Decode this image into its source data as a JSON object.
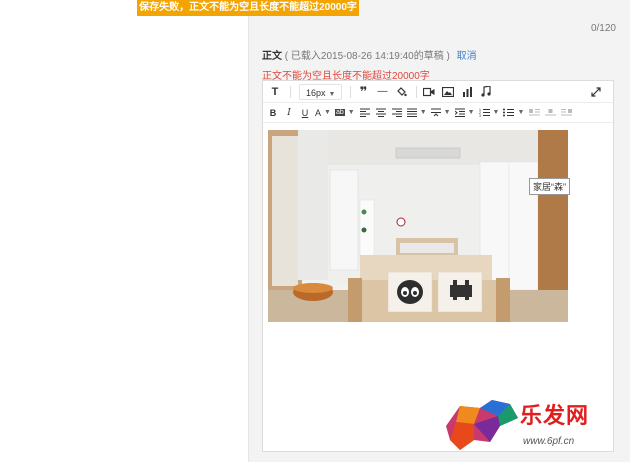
{
  "banner": {
    "error_message": "保存失败，正文不能为空且长度不能超过20000字"
  },
  "title_field": {
    "char_count": "0/120"
  },
  "body_field": {
    "label": "正文",
    "draft_note": "( 已载入2015-08-26 14:19:40的草稿 )",
    "cancel_label": "取消",
    "error_text": "正文不能为空且长度不能超过20000字"
  },
  "toolbar_main": {
    "text_icon": "T",
    "font_size": "16px",
    "quote_icon": "❞",
    "hr_icon": "—"
  },
  "toolbar_format": {
    "bold": "B",
    "italic": "I",
    "underline": "U",
    "font_color": "A",
    "bg_color": "ab"
  },
  "image": {
    "tooltip": "家居“森”"
  },
  "watermark": {
    "brand": "乐发网",
    "url": "www.6pf.cn"
  },
  "colors": {
    "banner_bg": "#f3a400",
    "error_red": "#e0483e",
    "link_blue": "#3a7fd0"
  }
}
